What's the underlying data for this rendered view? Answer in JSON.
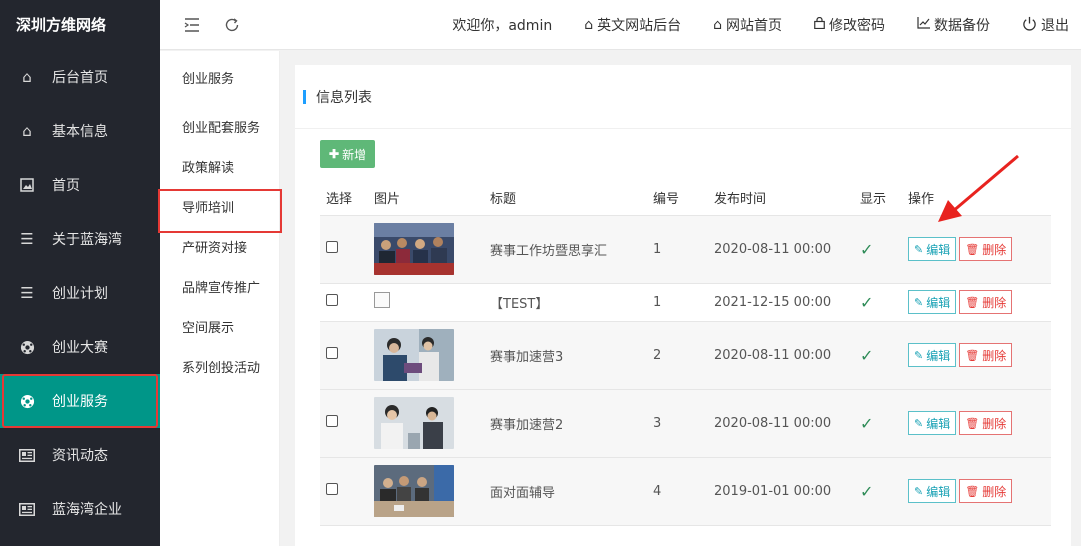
{
  "brand": "深圳方维网络",
  "sidebar": {
    "items": [
      {
        "label": "后台首页",
        "icon": "home-icon"
      },
      {
        "label": "基本信息",
        "icon": "home-icon"
      },
      {
        "label": "首页",
        "icon": "image-icon"
      },
      {
        "label": "关于蓝海湾",
        "icon": "menu-icon"
      },
      {
        "label": "创业计划",
        "icon": "menu-icon"
      },
      {
        "label": "创业大赛",
        "icon": "soccer-icon"
      },
      {
        "label": "创业服务",
        "icon": "soccer-icon",
        "active": true
      },
      {
        "label": "资讯动态",
        "icon": "news-icon"
      },
      {
        "label": "蓝海湾企业",
        "icon": "news-icon"
      }
    ]
  },
  "header": {
    "welcome": "欢迎你，admin",
    "links": [
      {
        "label": "英文网站后台",
        "icon": "home-icon"
      },
      {
        "label": "网站首页",
        "icon": "home-icon"
      },
      {
        "label": "修改密码",
        "icon": "lock-icon"
      },
      {
        "label": "数据备份",
        "icon": "chart-icon"
      },
      {
        "label": "退出",
        "icon": "power-icon"
      }
    ]
  },
  "subnav": {
    "items": [
      "创业服务",
      "创业配套服务",
      "政策解读",
      "导师培训",
      "产研资对接",
      "品牌宣传推广",
      "空间展示",
      "系列创投活动"
    ],
    "active_index": 3
  },
  "panel": {
    "title": "信息列表",
    "add_label": "新增",
    "columns": [
      "选择",
      "图片",
      "标题",
      "编号",
      "发布时间",
      "显示",
      "操作"
    ],
    "edit_label": "编辑",
    "delete_label": "删除",
    "rows": [
      {
        "title": "赛事工作坊暨思享汇",
        "id": "1",
        "date": "2020-08-11 00:00",
        "shown": "✓",
        "image": true
      },
      {
        "title": "【TEST】",
        "id": "1",
        "date": "2021-12-15 00:00",
        "shown": "✓",
        "image": false
      },
      {
        "title": "赛事加速营3",
        "id": "2",
        "date": "2020-08-11 00:00",
        "shown": "✓",
        "image": true
      },
      {
        "title": "赛事加速营2",
        "id": "3",
        "date": "2020-08-11 00:00",
        "shown": "✓",
        "image": true
      },
      {
        "title": "面对面辅导",
        "id": "4",
        "date": "2019-01-01 00:00",
        "shown": "✓",
        "image": true
      }
    ]
  }
}
